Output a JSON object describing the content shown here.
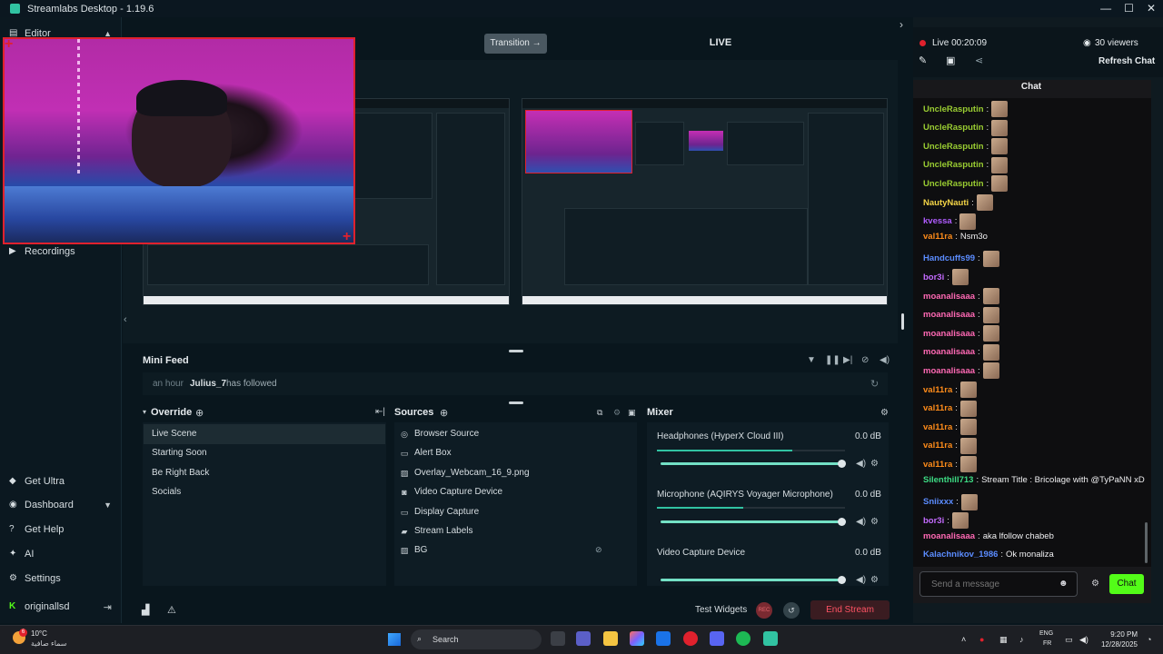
{
  "window": {
    "title": "Streamlabs Desktop - 1.19.6",
    "controls": [
      "—",
      "☐",
      "✕"
    ]
  },
  "sidebar": {
    "top_items": [
      {
        "label": "Editor",
        "icon": "editor-icon"
      },
      {
        "label": "Recordings",
        "icon": "play-circle-icon"
      }
    ],
    "bottom_items": [
      {
        "label": "Get Ultra",
        "icon": "ultra-icon"
      },
      {
        "label": "Dashboard",
        "icon": "dashboard-icon"
      },
      {
        "label": "Get Help",
        "icon": "help-icon"
      },
      {
        "label": "AI",
        "icon": "sparkle-icon"
      },
      {
        "label": "Settings",
        "icon": "gear-icon"
      }
    ],
    "account": "originallsd"
  },
  "editor": {
    "transition_label": "Transition →",
    "live_label": "LIVE"
  },
  "minifeed": {
    "title": "Mini Feed",
    "event": {
      "time": "an hour",
      "user": "Julius_7",
      "action": "has followed"
    }
  },
  "scenes": {
    "title": "Override",
    "items": [
      "Live Scene",
      "Starting Soon",
      "Be Right Back",
      "Socials"
    ],
    "active_index": 0
  },
  "sources": {
    "title": "Sources",
    "items": [
      {
        "label": "Browser Source",
        "icon": "globe-icon"
      },
      {
        "label": "Alert Box",
        "icon": "alert-box-icon"
      },
      {
        "label": "Overlay_Webcam_16_9.png",
        "icon": "image-icon"
      },
      {
        "label": "Video Capture Device",
        "icon": "camera-icon"
      },
      {
        "label": "Display Capture",
        "icon": "monitor-icon"
      },
      {
        "label": "Stream Labels",
        "icon": "folder-icon"
      },
      {
        "label": "BG",
        "icon": "image-icon"
      }
    ]
  },
  "mixer": {
    "title": "Mixer",
    "channels": [
      {
        "name": "Headphones (HyperX Cloud III)",
        "db": "0.0 dB",
        "level": 0.72
      },
      {
        "name": "Microphone (AQIRYS Voyager Microphone)",
        "db": "0.0 dB",
        "level": 0.46
      },
      {
        "name": "Video Capture Device",
        "db": "0.0 dB",
        "level": 0
      }
    ]
  },
  "footer": {
    "test_widgets": "Test Widgets",
    "rec_label": "REC",
    "end_stream": "End Stream"
  },
  "chat": {
    "live_status": "Live 00:20:09",
    "viewers": "30 viewers",
    "refresh": "Refresh Chat",
    "tab": "Chat",
    "messages": [
      {
        "user": "UncleRasputin",
        "color": "#9acd32",
        "text": "",
        "emote": true
      },
      {
        "user": "UncleRasputin",
        "color": "#9acd32",
        "text": "",
        "emote": true
      },
      {
        "user": "UncleRasputin",
        "color": "#9acd32",
        "text": "",
        "emote": true
      },
      {
        "user": "UncleRasputin",
        "color": "#9acd32",
        "text": "",
        "emote": true
      },
      {
        "user": "UncleRasputin",
        "color": "#9acd32",
        "text": "",
        "emote": true
      },
      {
        "user": "NautyNauti",
        "color": "#f5d547",
        "text": "",
        "emote": true
      },
      {
        "user": "kvessa",
        "color": "#b05cff",
        "text": "",
        "emote": true
      },
      {
        "user": "val11ra",
        "color": "#ff8c1a",
        "text": "Nsm3o",
        "emote": false
      },
      {
        "user": "Handcuffs99",
        "color": "#5b8cff",
        "text": "",
        "emote": true
      },
      {
        "user": "bor3i",
        "color": "#c46bff",
        "text": "",
        "emote": true
      },
      {
        "user": "moanalisaaa",
        "color": "#ff69b4",
        "text": "",
        "emote": true
      },
      {
        "user": "moanalisaaa",
        "color": "#ff69b4",
        "text": "",
        "emote": true
      },
      {
        "user": "moanalisaaa",
        "color": "#ff69b4",
        "text": "",
        "emote": true
      },
      {
        "user": "moanalisaaa",
        "color": "#ff69b4",
        "text": "",
        "emote": true
      },
      {
        "user": "moanalisaaa",
        "color": "#ff69b4",
        "text": "",
        "emote": true
      },
      {
        "user": "val11ra",
        "color": "#ff8c1a",
        "text": "",
        "emote": true
      },
      {
        "user": "val11ra",
        "color": "#ff8c1a",
        "text": "",
        "emote": true
      },
      {
        "user": "val11ra",
        "color": "#ff8c1a",
        "text": "",
        "emote": true
      },
      {
        "user": "val11ra",
        "color": "#ff8c1a",
        "text": "",
        "emote": true
      },
      {
        "user": "val11ra",
        "color": "#ff8c1a",
        "text": "",
        "emote": true
      },
      {
        "user": "Silenthill713",
        "color": "#3ddc84",
        "text": "Stream Title : Bricolage with @TyPaNN xD",
        "emote": false
      },
      {
        "user": "Sniixxx",
        "color": "#5b8cff",
        "text": "",
        "emote": true
      },
      {
        "user": "bor3i",
        "color": "#c46bff",
        "text": "",
        "emote": true
      },
      {
        "user": "moanalisaaa",
        "color": "#ff69b4",
        "text": "aka lfollow chabeb",
        "emote": false
      },
      {
        "user": "Kalachnikov_1986",
        "color": "#5b8cff",
        "text": "Ok monaliza",
        "emote": false
      }
    ],
    "input_placeholder": "Send a message",
    "send_label": "Chat"
  },
  "taskbar": {
    "weather_badge": "6",
    "temperature": "10°C",
    "weather_desc": "سماء صافية",
    "search_placeholder": "Search",
    "lang_line1": "ENG",
    "lang_line2": "FR",
    "time": "9:20 PM",
    "date": "12/28/2025"
  }
}
